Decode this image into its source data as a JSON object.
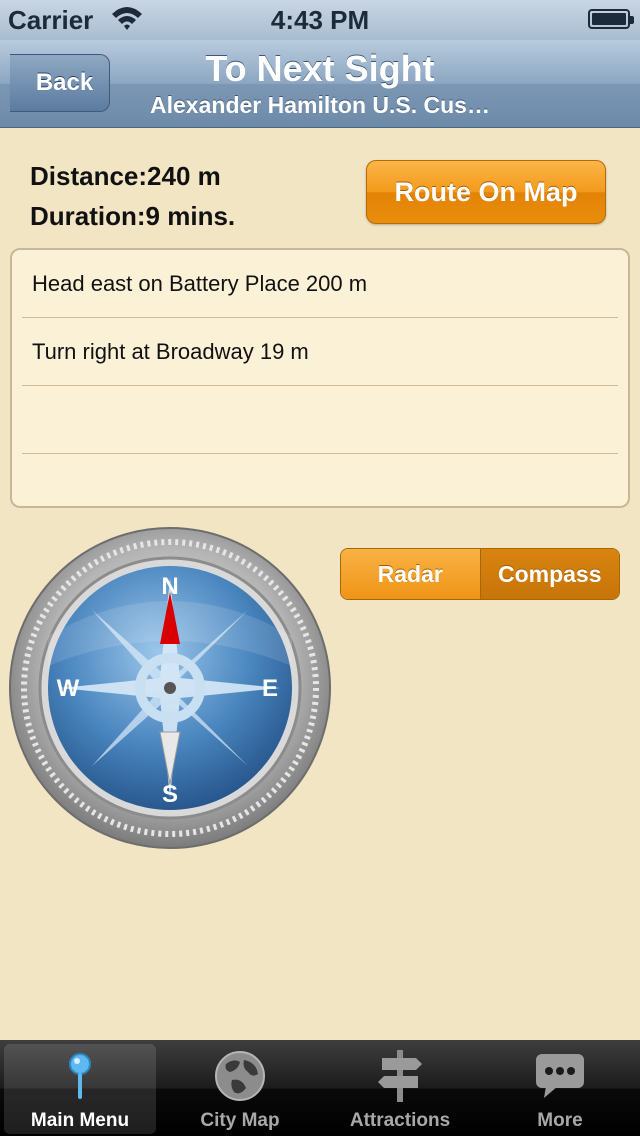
{
  "status_bar": {
    "carrier": "Carrier",
    "time": "4:43 PM"
  },
  "nav": {
    "back_label": "Back",
    "title": "To Next Sight",
    "subtitle": "Alexander Hamilton U.S. Cus…"
  },
  "stats": {
    "distance_label": "Distance:",
    "distance_value": "240 m",
    "duration_label": "Duration:",
    "duration_value": "9 mins."
  },
  "route_button": "Route On Map",
  "directions": [
    "Head east on Battery Place 200 m",
    "Turn right at Broadway 19 m",
    "",
    ""
  ],
  "segmented": {
    "options": [
      "Radar",
      "Compass"
    ],
    "selected": "Compass"
  },
  "compass": {
    "north": "N",
    "south": "S",
    "east": "E",
    "west": "W"
  },
  "tabs": [
    {
      "label": "Main Menu",
      "icon": "pin-icon",
      "active": true
    },
    {
      "label": "City Map",
      "icon": "globe-icon",
      "active": false
    },
    {
      "label": "Attractions",
      "icon": "signpost-icon",
      "active": false
    },
    {
      "label": "More",
      "icon": "speech-bubble-icon",
      "active": false
    }
  ],
  "colors": {
    "accent_orange": "#f39a1c",
    "nav_blue": "#7b97b4",
    "background": "#f1e5c4",
    "compass_blue": "#4a86bf",
    "needle_red": "#d80000"
  }
}
